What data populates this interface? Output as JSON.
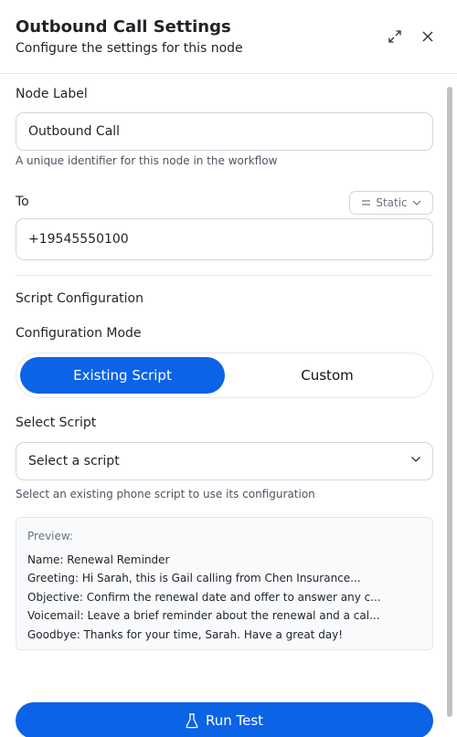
{
  "header": {
    "title": "Outbound Call Settings",
    "subtitle": "Configure the settings for this node"
  },
  "node_label": {
    "label": "Node Label",
    "value": "Outbound Call",
    "help": "A unique identifier for this node in the workflow"
  },
  "to": {
    "label": "To",
    "mode_button": "Static",
    "value": "+19545550100"
  },
  "script_config": {
    "section_title": "Script Configuration",
    "mode_label": "Configuration Mode",
    "modes": [
      "Existing Script",
      "Custom"
    ],
    "selected_mode": "Existing Script"
  },
  "select_script": {
    "label": "Select Script",
    "placeholder": "Select a script",
    "help": "Select an existing phone script to use its configuration"
  },
  "preview": {
    "heading": "Preview:",
    "lines": [
      "Name: Renewal Reminder",
      "Greeting: Hi Sarah, this is Gail calling from Chen Insurance...",
      "Objective: Confirm the renewal date and offer to answer any c...",
      "Voicemail: Leave a brief reminder about the renewal and a cal...",
      "Goodbye: Thanks for your time, Sarah. Have a great day!"
    ]
  },
  "actions": {
    "run_test": "Run Test"
  },
  "colors": {
    "accent": "#0b63e5",
    "border": "#d1d5db",
    "preview_bg": "#f9fafb"
  },
  "icons": [
    "expand-icon",
    "close-icon",
    "equals-icon",
    "chevron-down-icon",
    "flask-icon"
  ]
}
